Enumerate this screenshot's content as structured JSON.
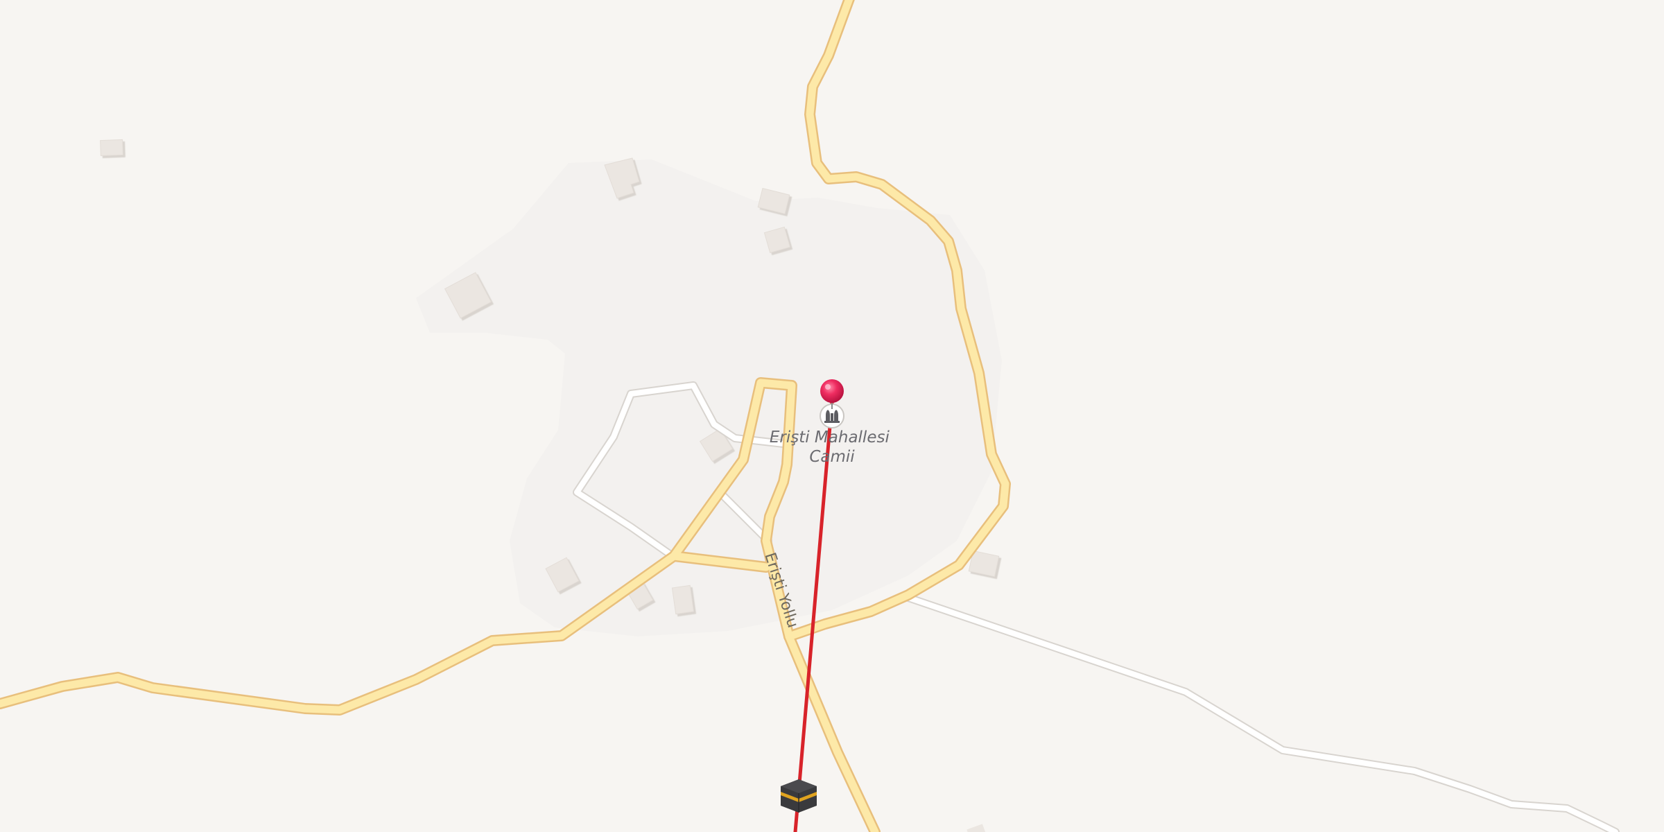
{
  "map": {
    "background_color": "#f7f5f2",
    "settlement_area_color": "#f3f1ef",
    "building_color": "#ebe6e1",
    "road_color": "#fde9a8",
    "road_casing_color": "#e8bf7c",
    "track_color": "#ffffff",
    "track_casing_color": "#d8d4cf",
    "qibla_line_color": "#d8232a",
    "road_names": [
      {
        "id": "eristi-yollu",
        "text": "Erişti Yollu"
      }
    ],
    "poi": {
      "name_line1": "Erişti Mahallesi",
      "name_line2": "Camii",
      "icon": "mosque-icon"
    },
    "markers": {
      "location_pin": {
        "icon": "location-pin-icon",
        "color": "#e8265a"
      },
      "kaaba": {
        "icon": "kaaba-icon",
        "color": "#3a3a3d"
      }
    }
  }
}
